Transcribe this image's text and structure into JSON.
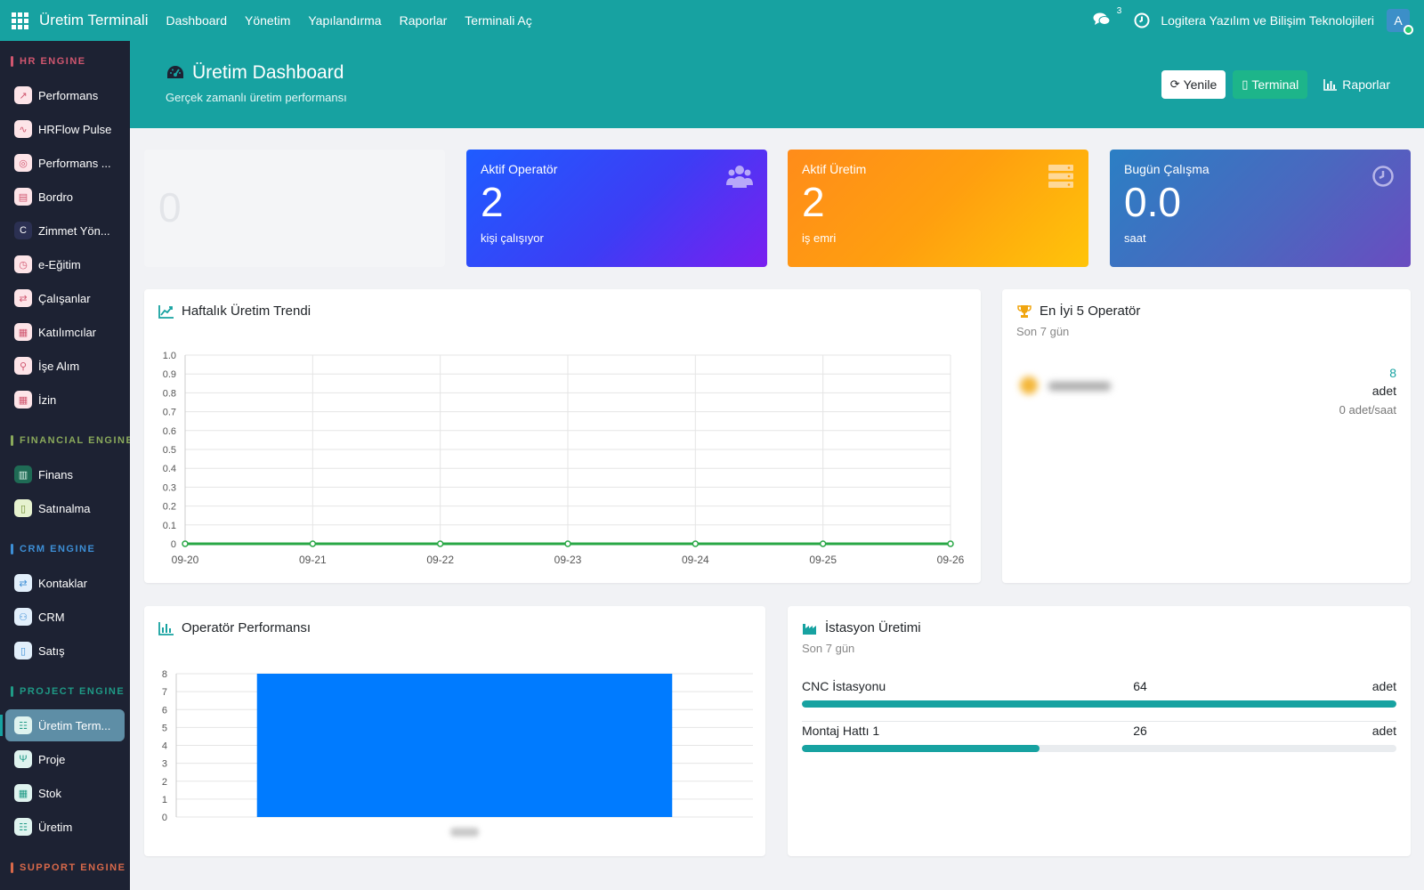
{
  "topbar": {
    "app_title": "Üretim Terminali",
    "nav": [
      "Dashboard",
      "Yönetim",
      "Yapılandırma",
      "Raporlar",
      "Terminali Aç"
    ],
    "chat_count": "3",
    "company": "Logitera Yazılım ve Bilişim Teknolojileri",
    "avatar_initial": "A"
  },
  "sidebar": {
    "sections": [
      {
        "title": "HR ENGINE",
        "color": "#d0566f",
        "items": [
          {
            "label": "Performans",
            "glyph": "↗",
            "icon_bg": "#fde4e8",
            "icon_fg": "#d0566f"
          },
          {
            "label": "HRFlow Pulse",
            "glyph": "∿",
            "icon_bg": "#fde4e8",
            "icon_fg": "#d0566f"
          },
          {
            "label": "Performans ...",
            "glyph": "◎",
            "icon_bg": "#fde4e8",
            "icon_fg": "#d0566f"
          },
          {
            "label": "Bordro",
            "glyph": "▤",
            "icon_bg": "#fde4e8",
            "icon_fg": "#d0566f"
          },
          {
            "label": "Zimmet Yön...",
            "glyph": "C",
            "icon_bg": "#2b3052",
            "icon_fg": "#ffffff"
          },
          {
            "label": "e-Eğitim",
            "glyph": "◷",
            "icon_bg": "#fde4e8",
            "icon_fg": "#d0566f"
          },
          {
            "label": "Çalışanlar",
            "glyph": "⇄",
            "icon_bg": "#fde4e8",
            "icon_fg": "#d0566f"
          },
          {
            "label": "Katılımcılar",
            "glyph": "▦",
            "icon_bg": "#fde4e8",
            "icon_fg": "#d0566f"
          },
          {
            "label": "İşe Alım",
            "glyph": "⚲",
            "icon_bg": "#fde4e8",
            "icon_fg": "#d0566f"
          },
          {
            "label": "İzin",
            "glyph": "▦",
            "icon_bg": "#fde4e8",
            "icon_fg": "#d0566f"
          }
        ]
      },
      {
        "title": "FINANCIAL ENGINE",
        "color": "#8aa95b",
        "items": [
          {
            "label": "Finans",
            "glyph": "▥",
            "icon_bg": "#1f6b55",
            "icon_fg": "#d9f2e8"
          },
          {
            "label": "Satınalma",
            "glyph": "▯",
            "icon_bg": "#e6f2cf",
            "icon_fg": "#6c8a2e"
          }
        ]
      },
      {
        "title": "CRM ENGINE",
        "color": "#3d8fd6",
        "items": [
          {
            "label": "Kontaklar",
            "glyph": "⇄",
            "icon_bg": "#e2effb",
            "icon_fg": "#3d8fd6"
          },
          {
            "label": "CRM",
            "glyph": "⚇",
            "icon_bg": "#e2effb",
            "icon_fg": "#3d8fd6"
          },
          {
            "label": "Satış",
            "glyph": "▯",
            "icon_bg": "#e2effb",
            "icon_fg": "#3d8fd6"
          }
        ]
      },
      {
        "title": "PROJECT ENGINE",
        "color": "#1f9a86",
        "items": [
          {
            "label": "Üretim Term...",
            "glyph": "☷",
            "icon_bg": "#dff3ef",
            "icon_fg": "#1f9a86",
            "active": true
          },
          {
            "label": "Proje",
            "glyph": "Ψ",
            "icon_bg": "#dff3ef",
            "icon_fg": "#1f9a86"
          },
          {
            "label": "Stok",
            "glyph": "▦",
            "icon_bg": "#dff3ef",
            "icon_fg": "#1f9a86"
          },
          {
            "label": "Üretim",
            "glyph": "☷",
            "icon_bg": "#dff3ef",
            "icon_fg": "#1f9a86"
          }
        ]
      },
      {
        "title": "SUPPORT ENGINE",
        "color": "#d9694a",
        "items": []
      }
    ]
  },
  "header": {
    "title": "Üretim Dashboard",
    "subtitle": "Gerçek zamanlı üretim performansı",
    "refresh_label": "Yenile",
    "terminal_label": "Terminal",
    "reports_label": "Raporlar"
  },
  "stats": {
    "blank_value": "0",
    "operators": {
      "label": "Aktif Operatör",
      "value": "2",
      "unit": "kişi çalışıyor"
    },
    "production": {
      "label": "Aktif Üretim",
      "value": "2",
      "unit": "iş emri"
    },
    "work_today": {
      "label": "Bugün Çalışma",
      "value": "0.0",
      "unit": "saat"
    }
  },
  "weekly_trend": {
    "title": "Haftalık Üretim Trendi"
  },
  "top_operators": {
    "title": "En İyi 5 Operatör",
    "subtitle": "Son 7 gün",
    "rows": [
      {
        "count": "8",
        "unit": "adet",
        "rate": "0 adet/saat"
      }
    ]
  },
  "operator_performance": {
    "title": "Operatör Performansı"
  },
  "station_production": {
    "title": "İstasyon Üretimi",
    "subtitle": "Son 7 gün",
    "stations": [
      {
        "name": "CNC İstasyonu",
        "value": 64,
        "unit": "adet",
        "fill": 1.0
      },
      {
        "name": "Montaj Hattı 1",
        "value": 26,
        "unit": "adet",
        "fill": 0.4
      }
    ]
  },
  "chart_data": [
    {
      "type": "line",
      "title": "Haftalık Üretim Trendi",
      "x": [
        "09-20",
        "09-21",
        "09-22",
        "09-23",
        "09-24",
        "09-25",
        "09-26"
      ],
      "series": [
        {
          "values": [
            0,
            0,
            0,
            0,
            0,
            0,
            0
          ],
          "color": "#28a745"
        }
      ],
      "ylim": [
        0,
        1
      ],
      "yticks": [
        "0",
        "0.1",
        "0.2",
        "0.3",
        "0.4",
        "0.5",
        "0.6",
        "0.7",
        "0.8",
        "0.9",
        "1.0"
      ],
      "grid": true
    },
    {
      "type": "bar",
      "title": "Operatör Performansı",
      "categories": [
        ""
      ],
      "values": [
        8
      ],
      "color": "#007bff",
      "ylim": [
        0,
        8
      ],
      "yticks": [
        "0",
        "1",
        "2",
        "3",
        "4",
        "5",
        "6",
        "7",
        "8"
      ],
      "grid": true
    }
  ]
}
